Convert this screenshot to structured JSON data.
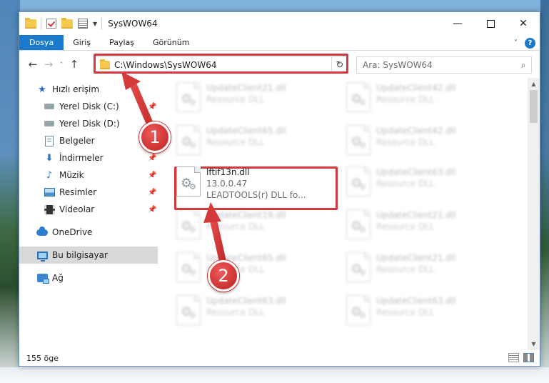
{
  "window": {
    "title": "SysWOW64",
    "controls": {
      "minimize": "—",
      "maximize": "",
      "close": "✕"
    }
  },
  "ribbon": {
    "tabs": [
      "Dosya",
      "Giriş",
      "Paylaş",
      "Görünüm"
    ],
    "active_tab": "Dosya",
    "expand": "˅",
    "help": "?"
  },
  "nav": {
    "back": "←",
    "forward": "→",
    "recent": "˅",
    "up": "↑",
    "address": "C:\\Windows\\SysWOW64",
    "address_dropdown": "˅",
    "refresh": "↻",
    "search_placeholder": "Ara: SysWOW64",
    "search_icon": "⌕"
  },
  "sidebar": {
    "items": [
      {
        "label": "Hızlı erişim",
        "icon": "star-icon",
        "pinned": false
      },
      {
        "label": "Yerel Disk (C:)",
        "icon": "disk-icon",
        "pinned": true
      },
      {
        "label": "Yerel Disk (D:)",
        "icon": "disk-icon",
        "pinned": false
      },
      {
        "label": "Belgeler",
        "icon": "documents-icon",
        "pinned": false
      },
      {
        "label": "İndirmeler",
        "icon": "download-icon",
        "pinned": true
      },
      {
        "label": "Müzik",
        "icon": "music-icon",
        "pinned": true
      },
      {
        "label": "Resimler",
        "icon": "pictures-icon",
        "pinned": true
      },
      {
        "label": "Videolar",
        "icon": "videos-icon",
        "pinned": true
      },
      {
        "label": "OneDrive",
        "icon": "cloud-icon",
        "pinned": false
      },
      {
        "label": "Bu bilgisayar",
        "icon": "computer-icon",
        "pinned": false
      },
      {
        "label": "Ağ",
        "icon": "network-icon",
        "pinned": false
      }
    ],
    "pin_glyph": "📌",
    "selected": "Bu bilgisayar"
  },
  "files": {
    "left": [
      {
        "name": "UpdateClient21.dll",
        "sub": "Resource DLL"
      },
      {
        "name": "UpdateClient65.dll",
        "sub": "Resource DLL"
      },
      {
        "name": "lftif13n.dll",
        "version": "13.0.0.47",
        "sub": "LEADTOOLS(r) DLL fo..."
      },
      {
        "name": "UpdateClient19.dll",
        "sub": "Resource DLL"
      },
      {
        "name": "UpdateClient65.dll",
        "sub": "Resource DLL"
      },
      {
        "name": "UpdateClient63.dll",
        "sub": "Resource DLL"
      }
    ],
    "right": [
      {
        "name": "UpdateClient42.dll",
        "sub": "Resource DLL"
      },
      {
        "name": "UpdateClient42.dll",
        "sub": "Resource DLL"
      },
      {
        "name": "UpdateClient63.dll",
        "sub": "Resource DLL"
      },
      {
        "name": "UpdateClient21.dll",
        "sub": "Resource DLL"
      },
      {
        "name": "UpdateClient21.dll",
        "sub": "Resource DLL"
      },
      {
        "name": "UpdateClient63.dll",
        "sub": "Resource DLL"
      }
    ],
    "highlighted": "lftif13n.dll"
  },
  "status": {
    "count": "155 öge"
  },
  "annotations": {
    "step1": "1",
    "step2": "2",
    "color": "#d3393c"
  }
}
